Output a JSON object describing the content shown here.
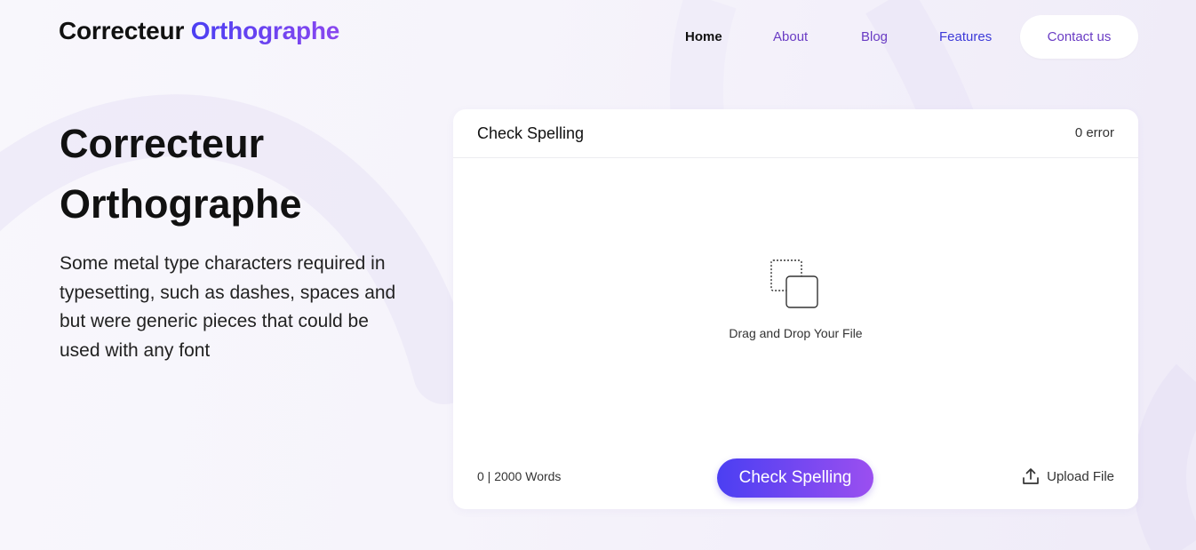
{
  "header": {
    "logo_part1": "Correcteur",
    "logo_part2": "Orthographe",
    "nav": {
      "home": "Home",
      "about": "About",
      "blog": "Blog",
      "features": "Features",
      "contact": "Contact us"
    }
  },
  "hero": {
    "title_line1": "Correcteur",
    "title_line2": "Orthographe",
    "description": "Some metal type characters required in typesetting, such as dashes, spaces and but were generic pieces that could be used with any font"
  },
  "checker": {
    "title": "Check Spelling",
    "error_count": "0 error",
    "drop_text": "Drag and Drop Your File",
    "word_count": "0 | 2000 Words",
    "check_button": "Check Spelling",
    "upload_label": "Upload File",
    "icons": {
      "drop": "copy-icon",
      "upload": "upload-icon"
    }
  },
  "colors": {
    "accent_start": "#4b3ff2",
    "accent_end": "#9b4ff0",
    "nav_link": "#6a3cc4"
  }
}
